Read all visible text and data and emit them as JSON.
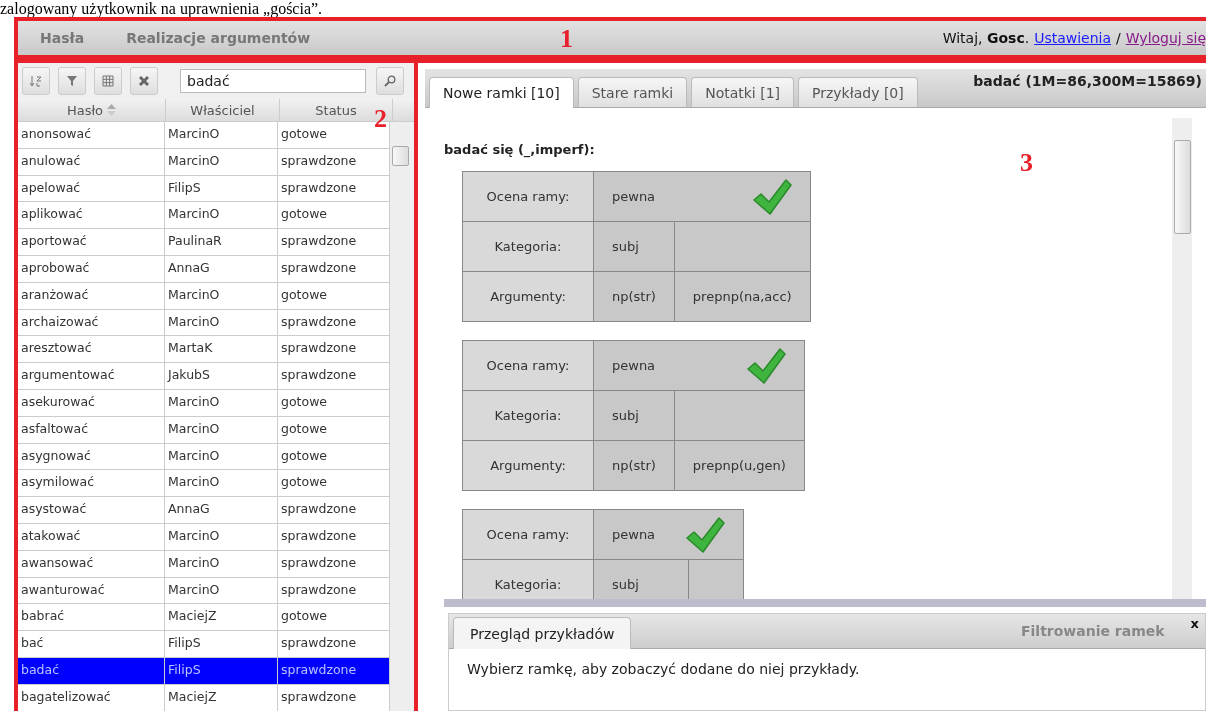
{
  "caption": "zalogowany użytkownik na uprawnienia „gościa”.",
  "annotations": [
    "1",
    "2",
    "3"
  ],
  "top_bar": {
    "nav": [
      {
        "label": "Hasła"
      },
      {
        "label": "Realizacje argumentów"
      }
    ],
    "greeting": "Witaj, **Gosc**.",
    "links": [
      "Ustawienia",
      "Wyloguj się"
    ],
    "separator": "/"
  },
  "grid": {
    "search": {
      "value": "badać"
    },
    "columns": [
      {
        "label": "Hasło",
        "sorted": true
      },
      {
        "label": "Właściciel",
        "sorted": false
      },
      {
        "label": "Status",
        "sorted": false
      }
    ],
    "rows": [
      {
        "cells": [
          "anonsować",
          "MarcinO",
          "gotowe"
        ],
        "selected": false
      },
      {
        "cells": [
          "anulować",
          "MarcinO",
          "sprawdzone"
        ],
        "selected": false
      },
      {
        "cells": [
          "apelować",
          "FilipS",
          "sprawdzone"
        ],
        "selected": false
      },
      {
        "cells": [
          "aplikować",
          "MarcinO",
          "gotowe"
        ],
        "selected": false
      },
      {
        "cells": [
          "aportować",
          "PaulinaR",
          "sprawdzone"
        ],
        "selected": false
      },
      {
        "cells": [
          "aprobować",
          "AnnaG",
          "sprawdzone"
        ],
        "selected": false
      },
      {
        "cells": [
          "aranżować",
          "MarcinO",
          "gotowe"
        ],
        "selected": false
      },
      {
        "cells": [
          "archaizować",
          "MarcinO",
          "sprawdzone"
        ],
        "selected": false
      },
      {
        "cells": [
          "aresztować",
          "MartaK",
          "sprawdzone"
        ],
        "selected": false
      },
      {
        "cells": [
          "argumentować",
          "JakubS",
          "sprawdzone"
        ],
        "selected": false
      },
      {
        "cells": [
          "asekurować",
          "MarcinO",
          "gotowe"
        ],
        "selected": false
      },
      {
        "cells": [
          "asfaltować",
          "MarcinO",
          "gotowe"
        ],
        "selected": false
      },
      {
        "cells": [
          "asygnować",
          "MarcinO",
          "gotowe"
        ],
        "selected": false
      },
      {
        "cells": [
          "asymilować",
          "MarcinO",
          "gotowe"
        ],
        "selected": false
      },
      {
        "cells": [
          "asystować",
          "AnnaG",
          "sprawdzone"
        ],
        "selected": false
      },
      {
        "cells": [
          "atakować",
          "MarcinO",
          "sprawdzone"
        ],
        "selected": false
      },
      {
        "cells": [
          "awansować",
          "MarcinO",
          "sprawdzone"
        ],
        "selected": false
      },
      {
        "cells": [
          "awanturować",
          "MarcinO",
          "sprawdzone"
        ],
        "selected": false
      },
      {
        "cells": [
          "babrać",
          "MaciejZ",
          "gotowe"
        ],
        "selected": false
      },
      {
        "cells": [
          "bać",
          "FilipS",
          "sprawdzone"
        ],
        "selected": false
      },
      {
        "cells": [
          "badać",
          "FilipS",
          "sprawdzone"
        ],
        "selected": true
      },
      {
        "cells": [
          "bagatelizować",
          "MaciejZ",
          "sprawdzone"
        ],
        "selected": false
      }
    ]
  },
  "tabs": [
    {
      "label": "Nowe ramki [10]",
      "selected": true
    },
    {
      "label": "Stare ramki",
      "selected": false
    },
    {
      "label": "Notatki [1]",
      "selected": false
    },
    {
      "label": "Przykłady [0]",
      "selected": false
    }
  ],
  "entry_title": "badać (1M=86,300M=15869)",
  "frame_heading": "badać się (_,imperf):",
  "frames": [
    {
      "rows": [
        {
          "label": "Ocena ramy:",
          "cells": [
            {
              "text": "pewna",
              "colspan": 2
            }
          ]
        },
        {
          "label": "Kategoria:",
          "cells": [
            "subj",
            ""
          ]
        },
        {
          "label": "Argumenty:",
          "cells": [
            "np(str)",
            "prepnp(na,acc)"
          ]
        }
      ]
    },
    {
      "rows": [
        {
          "label": "Ocena ramy:",
          "cells": [
            {
              "text": "pewna",
              "colspan": 2
            }
          ]
        },
        {
          "label": "Kategoria:",
          "cells": [
            "subj",
            ""
          ]
        },
        {
          "label": "Argumenty:",
          "cells": [
            "np(str)",
            "prepnp(u,gen)"
          ]
        }
      ]
    },
    {
      "rows": [
        {
          "label": "Ocena ramy:",
          "cells": [
            {
              "text": "pewna",
              "colspan": 2
            }
          ]
        },
        {
          "label": "Kategoria:",
          "cells": [
            "subj",
            ""
          ]
        }
      ]
    }
  ],
  "bottom_panel": {
    "tabs": [
      {
        "label": "Przegląd przykładów",
        "selected": true
      }
    ],
    "filter_title": "Filtrowanie ramek",
    "close": "x",
    "message": "Wybierz ramkę, aby zobaczyć dodane do niej przykłady."
  }
}
